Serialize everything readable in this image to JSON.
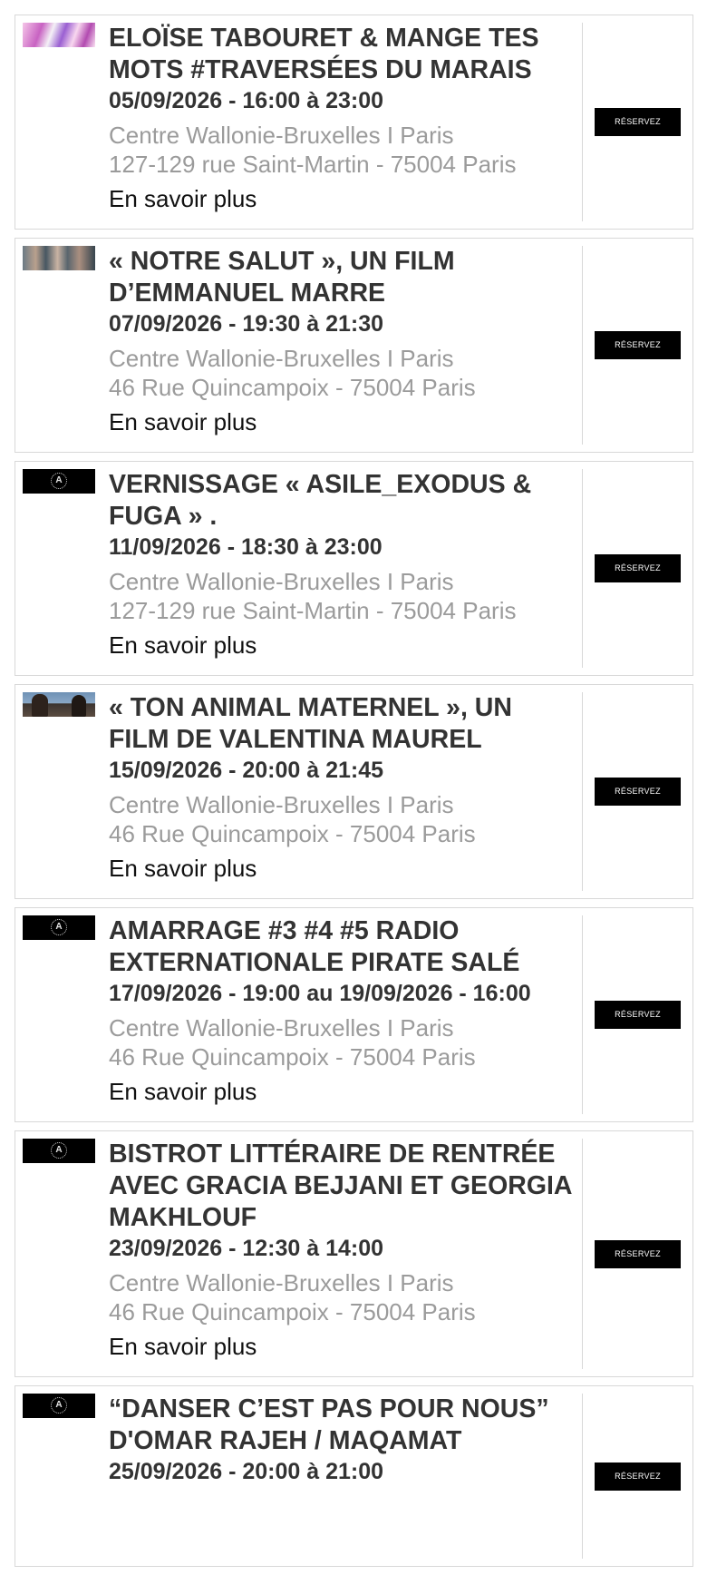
{
  "events": [
    {
      "thumb": "pink-abstract-image",
      "title": "ELOÏSE TABOURET & MANGE TES MOTS #TRAVERSÉES DU MARAIS",
      "date": "05/09/2026 - 16:00 à 23:00",
      "venue": "Centre Wallonie-Bruxelles I Paris",
      "address": "127-129 rue Saint-Martin - 75004 Paris",
      "more_label": "En savoir plus",
      "button_label": "RÉSERVEZ"
    },
    {
      "thumb": "crowd-photo-image",
      "title": "« NOTRE SALUT », UN FILM D’EMMANUEL MARRE",
      "date": "07/09/2026 - 19:30 à 21:30",
      "venue": "Centre Wallonie-Bruxelles I Paris",
      "address": "46 Rue Quincampoix - 75004 Paris",
      "more_label": "En savoir plus",
      "button_label": "RÉSERVEZ"
    },
    {
      "thumb": "logo-image",
      "title": "VERNISSAGE « ASILE_EXODUS & FUGA » .",
      "date": "11/09/2026 - 18:30 à 23:00",
      "venue": "Centre Wallonie-Bruxelles I Paris",
      "address": "127-129 rue Saint-Martin - 75004 Paris",
      "more_label": "En savoir plus",
      "button_label": "RÉSERVEZ"
    },
    {
      "thumb": "beach-photo-image",
      "title": "« TON ANIMAL MATERNEL », UN FILM DE VALENTINA MAUREL",
      "date": "15/09/2026 - 20:00 à 21:45",
      "venue": "Centre Wallonie-Bruxelles I Paris",
      "address": "46 Rue Quincampoix - 75004 Paris",
      "more_label": "En savoir plus",
      "button_label": "RÉSERVEZ"
    },
    {
      "thumb": "logo-image",
      "title": "AMARRAGE #3 #4 #5 RADIO EXTERNATIONALE PIRATE SALÉ",
      "date": "17/09/2026 - 19:00 au 19/09/2026 - 16:00",
      "venue": "Centre Wallonie-Bruxelles I Paris",
      "address": "46 Rue Quincampoix - 75004 Paris",
      "more_label": "En savoir plus",
      "button_label": "RÉSERVEZ"
    },
    {
      "thumb": "logo-image",
      "title": "BISTROT LITTÉRAIRE DE RENTRÉE AVEC GRACIA BEJJANI ET GEORGIA MAKHLOUF",
      "date": "23/09/2026 - 12:30 à 14:00",
      "venue": "Centre Wallonie-Bruxelles I Paris",
      "address": "46 Rue Quincampoix - 75004 Paris",
      "more_label": "En savoir plus",
      "button_label": "RÉSERVEZ"
    },
    {
      "thumb": "logo-image",
      "title": "“DANSER C’EST PAS POUR NOUS” D'OMAR RAJEH / MAQAMAT",
      "date": "25/09/2026 - 20:00 à 21:00",
      "venue": "",
      "address": "",
      "more_label": "",
      "button_label": "RÉSERVEZ"
    }
  ]
}
